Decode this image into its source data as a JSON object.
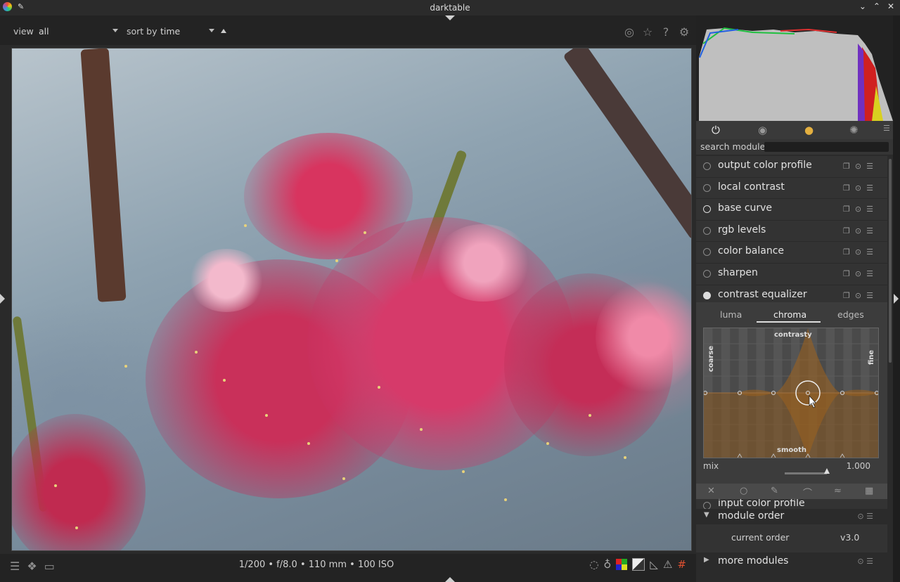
{
  "window": {
    "title": "darktable"
  },
  "topbar": {
    "view_label": "view",
    "view_value": "all",
    "sort_label": "sort by",
    "sort_value": "time"
  },
  "bottombar": {
    "exif": "1/200 • f/8.0 • 110 mm • 100 ISO"
  },
  "search": {
    "label": "search module"
  },
  "modules": [
    {
      "name": "output color profile"
    },
    {
      "name": "local contrast"
    },
    {
      "name": "base curve"
    },
    {
      "name": "rgb levels"
    },
    {
      "name": "color balance"
    },
    {
      "name": "sharpen"
    },
    {
      "name": "contrast equalizer"
    }
  ],
  "equalizer": {
    "tabs": [
      "luma",
      "chroma",
      "edges"
    ],
    "active_tab": "chroma",
    "graph_top": "contrasty",
    "graph_bottom": "smooth",
    "graph_left": "coarse",
    "graph_right": "fine",
    "mix_label": "mix",
    "mix_value": "1.000"
  },
  "next_module": {
    "name": "input color profile"
  },
  "module_order": {
    "title": "module order",
    "label": "current order",
    "value": "v3.0"
  },
  "more_modules": {
    "title": "more modules"
  },
  "icons": {
    "top": [
      "color-picker-icon",
      "star-icon",
      "help-icon",
      "gear-icon"
    ],
    "bottom_left": [
      "presets-icon",
      "styles-icon",
      "second-window-icon"
    ],
    "bottom_right": [
      "focus-peaking-icon",
      "bulb-icon",
      "gamut-check-icon",
      "soft-proof-icon",
      "guides-icon",
      "overexposed-icon",
      "raw-overexposed-icon"
    ]
  }
}
